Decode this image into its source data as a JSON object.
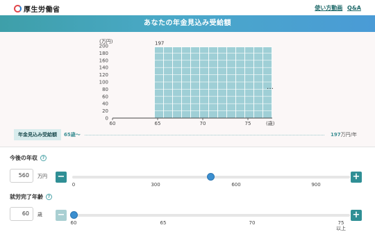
{
  "header": {
    "logo_text": "厚生労働省",
    "links": [
      "使い方動画",
      "Q&A"
    ]
  },
  "page_title": "あなたの年金見込み受給額",
  "chart_data": {
    "type": "bar",
    "ylabel": "(万円)",
    "xlabel": "(歳)",
    "ylim": [
      0,
      200
    ],
    "yticks": [
      0,
      20,
      40,
      60,
      80,
      100,
      120,
      140,
      160,
      180,
      200
    ],
    "xticks": [
      60,
      65,
      70,
      75
    ],
    "categories": [
      65,
      66,
      67,
      68,
      69,
      70,
      71,
      72,
      73,
      74,
      75,
      76,
      77
    ],
    "values": [
      197,
      197,
      197,
      197,
      197,
      197,
      197,
      197,
      197,
      197,
      197,
      197,
      197
    ],
    "data_label": "197",
    "continuation": "…",
    "colors": {
      "bar": "#9fcfd6",
      "bar_edge": "#7fb9c2",
      "axis": "#444444"
    }
  },
  "summary": {
    "label": "年金見込み受給額",
    "age": "65歳〜",
    "amount": "197",
    "unit": "万円/年"
  },
  "controls": {
    "income": {
      "title": "今後の年収",
      "help": "?",
      "value": "560",
      "unit": "万円",
      "minus": "−",
      "plus": "+",
      "ticks": [
        "0",
        "300",
        "600",
        "900"
      ],
      "range": [
        0,
        1200
      ],
      "current": 560
    },
    "retire": {
      "title": "就労完了年齢",
      "help": "?",
      "value": "60",
      "unit": "歳",
      "minus": "−",
      "plus": "+",
      "ticks": [
        "60",
        "65",
        "70",
        "75"
      ],
      "tick_suffix": "以上",
      "range": [
        60,
        75
      ],
      "current": 60
    }
  },
  "colors": {
    "accent": "#2f8f95",
    "slider_knob": "#3b8fd0",
    "band_start": "#3e9fa9",
    "band_end": "#4a9bd6"
  }
}
